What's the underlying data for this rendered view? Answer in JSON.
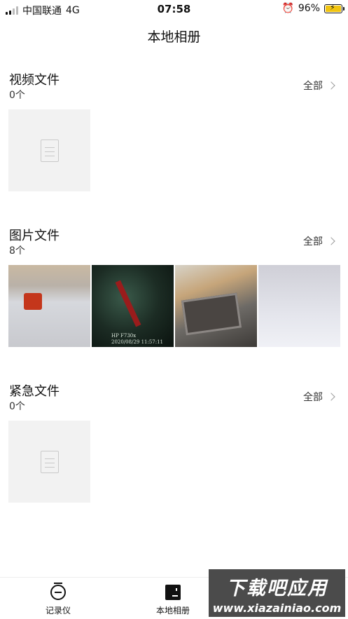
{
  "status_bar": {
    "carrier": "中国联通",
    "network": "4G",
    "time": "07:58",
    "battery": "96%"
  },
  "header": {
    "title": "本地相册"
  },
  "sections": [
    {
      "title": "视频文件",
      "count": "0个",
      "all_label": "全部"
    },
    {
      "title": "图片文件",
      "count": "8个",
      "all_label": "全部"
    },
    {
      "title": "紧急文件",
      "count": "0个",
      "all_label": "全部"
    }
  ],
  "photo_overlay": {
    "line1": "HP F730x",
    "line2": "2020/08/29 11:57:11"
  },
  "tabbar": {
    "items": [
      {
        "label": "记录仪",
        "icon": "dashcam-icon"
      },
      {
        "label": "本地相册",
        "icon": "album-icon"
      }
    ]
  },
  "watermark": {
    "line1": "下载吧应用",
    "line2": "www.xiazainiao.com"
  },
  "colors": {
    "background": "#ffffff",
    "placeholder": "#f2f2f2",
    "text": "#111111"
  }
}
